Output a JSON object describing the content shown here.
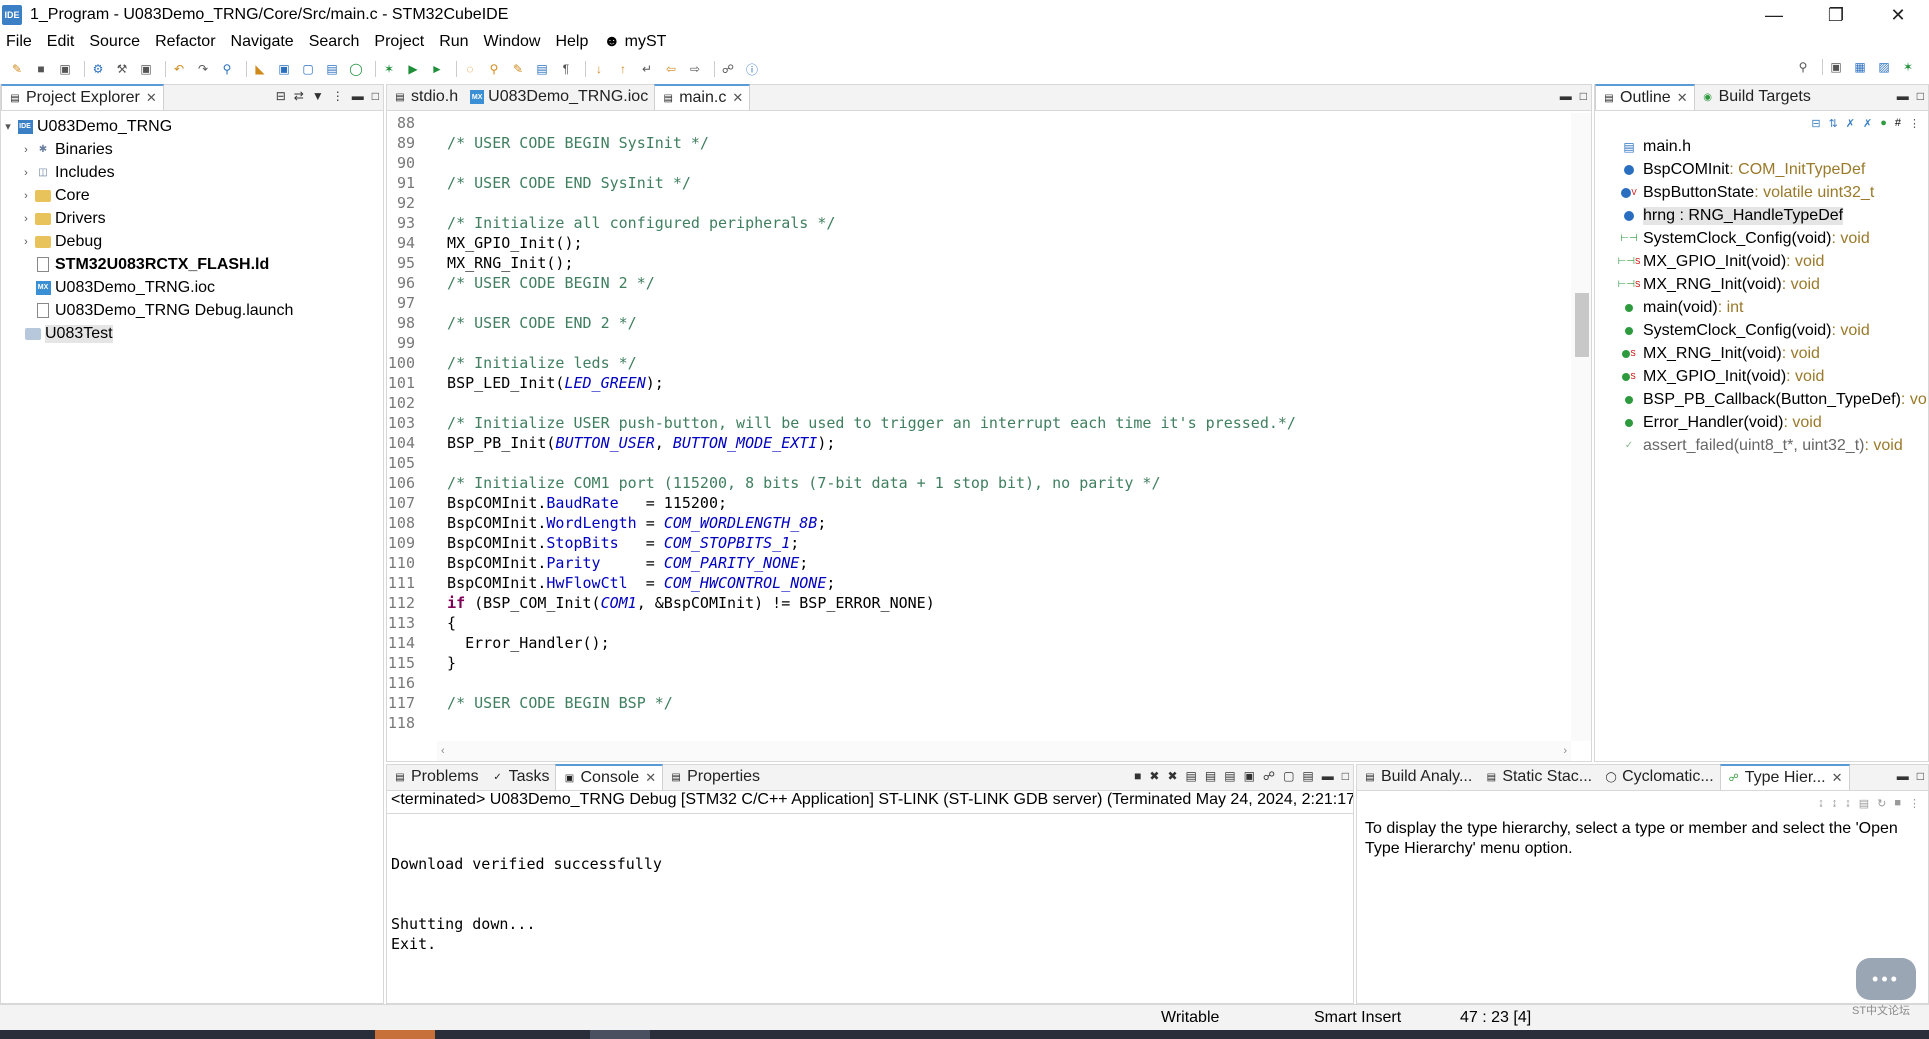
{
  "window": {
    "title": "1_Program - U083Demo_TRNG/Core/Src/main.c - STM32CubeIDE",
    "app_icon": "IDE"
  },
  "menu": [
    "File",
    "Edit",
    "Source",
    "Refactor",
    "Navigate",
    "Search",
    "Project",
    "Run",
    "Window",
    "Help",
    "myST"
  ],
  "project_explorer": {
    "tab_label": "Project Explorer",
    "tree": [
      {
        "label": "U083Demo_TRNG",
        "icon": "project-icon",
        "expanded": true
      },
      {
        "label": "Binaries",
        "icon": "binaries-icon"
      },
      {
        "label": "Includes",
        "icon": "includes-icon"
      },
      {
        "label": "Core",
        "icon": "folder-icon"
      },
      {
        "label": "Drivers",
        "icon": "folder-icon"
      },
      {
        "label": "Debug",
        "icon": "folder-icon"
      },
      {
        "label": "STM32U083RCTX_FLASH.ld",
        "icon": "linker-file-icon"
      },
      {
        "label": "U083Demo_TRNG.ioc",
        "icon": "mx-file-icon"
      },
      {
        "label": "U083Demo_TRNG Debug.launch",
        "icon": "launch-file-icon"
      },
      {
        "label": "U083Test",
        "icon": "closed-project-icon"
      }
    ]
  },
  "editor": {
    "tabs": [
      {
        "label": "stdio.h",
        "icon": "c-file-icon"
      },
      {
        "label": "U083Demo_TRNG.ioc",
        "icon": "mx-file-icon"
      },
      {
        "label": "main.c",
        "icon": "c-file-icon",
        "active": true
      }
    ],
    "lines": [
      {
        "n": "88",
        "t": ""
      },
      {
        "n": "89",
        "t": "  /* USER CODE BEGIN SysInit */"
      },
      {
        "n": "90",
        "t": ""
      },
      {
        "n": "91",
        "t": "  /* USER CODE END SysInit */"
      },
      {
        "n": "92",
        "t": ""
      },
      {
        "n": "93",
        "t": "  /* Initialize all configured peripherals */"
      },
      {
        "n": "94",
        "t": "  MX_GPIO_Init();"
      },
      {
        "n": "95",
        "t": "  MX_RNG_Init();"
      },
      {
        "n": "96",
        "t": "  /* USER CODE BEGIN 2 */"
      },
      {
        "n": "97",
        "t": ""
      },
      {
        "n": "98",
        "t": "  /* USER CODE END 2 */"
      },
      {
        "n": "99",
        "t": ""
      },
      {
        "n": "100",
        "t": "  /* Initialize leds */"
      },
      {
        "n": "101",
        "t": "  BSP_LED_Init(LED_GREEN);"
      },
      {
        "n": "102",
        "t": ""
      },
      {
        "n": "103",
        "t": "  /* Initialize USER push-button, will be used to trigger an interrupt each time it's pressed.*/"
      },
      {
        "n": "104",
        "t": "  BSP_PB_Init(BUTTON_USER, BUTTON_MODE_EXTI);"
      },
      {
        "n": "105",
        "t": ""
      },
      {
        "n": "106",
        "t": "  /* Initialize COM1 port (115200, 8 bits (7-bit data + 1 stop bit), no parity */"
      },
      {
        "n": "107",
        "t": "  BspCOMInit.BaudRate   = 115200;"
      },
      {
        "n": "108",
        "t": "  BspCOMInit.WordLength = COM_WORDLENGTH_8B;"
      },
      {
        "n": "109",
        "t": "  BspCOMInit.StopBits   = COM_STOPBITS_1;"
      },
      {
        "n": "110",
        "t": "  BspCOMInit.Parity     = COM_PARITY_NONE;"
      },
      {
        "n": "111",
        "t": "  BspCOMInit.HwFlowCtl  = COM_HWCONTROL_NONE;"
      },
      {
        "n": "112",
        "t": "  if (BSP_COM_Init(COM1, &BspCOMInit) != BSP_ERROR_NONE)"
      },
      {
        "n": "113",
        "t": "  {"
      },
      {
        "n": "114",
        "t": "    Error_Handler();"
      },
      {
        "n": "115",
        "t": "  }"
      },
      {
        "n": "116",
        "t": ""
      },
      {
        "n": "117",
        "t": "  /* USER CODE BEGIN BSP */"
      },
      {
        "n": "118",
        "t": ""
      }
    ]
  },
  "outline": {
    "tabs": [
      {
        "label": "Outline"
      },
      {
        "label": "Build Targets"
      }
    ],
    "items": [
      {
        "name": "main.h",
        "type": "",
        "icon": "include-icon"
      },
      {
        "name": "BspCOMInit",
        "type": " : COM_InitTypeDef",
        "icon": "variable-icon"
      },
      {
        "name": "BspButtonState",
        "type": " : volatile uint32_t",
        "icon": "volatile-variable-icon"
      },
      {
        "name": "hrng : RNG_HandleTypeDef",
        "type": "",
        "icon": "variable-icon",
        "selected": true
      },
      {
        "name": "SystemClock_Config(void)",
        "type": " : void",
        "icon": "function-decl-icon"
      },
      {
        "name": "MX_GPIO_Init(void)",
        "type": " : void",
        "icon": "static-function-decl-icon"
      },
      {
        "name": "MX_RNG_Init(void)",
        "type": " : void",
        "icon": "static-function-decl-icon"
      },
      {
        "name": "main(void)",
        "type": " : int",
        "icon": "function-icon"
      },
      {
        "name": "SystemClock_Config(void)",
        "type": " : void",
        "icon": "function-icon"
      },
      {
        "name": "MX_RNG_Init(void)",
        "type": " : void",
        "icon": "static-function-icon"
      },
      {
        "name": "MX_GPIO_Init(void)",
        "type": " : void",
        "icon": "static-function-icon"
      },
      {
        "name": "BSP_PB_Callback(Button_TypeDef)",
        "type": " : vo",
        "icon": "function-icon"
      },
      {
        "name": "Error_Handler(void)",
        "type": " : void",
        "icon": "function-icon"
      },
      {
        "name": "assert_failed(uint8_t*, uint32_t)",
        "type": " : void",
        "icon": "inactive-function-icon",
        "muted": true
      }
    ]
  },
  "console": {
    "tabs": [
      {
        "label": "Problems",
        "icon": "problems-icon"
      },
      {
        "label": "Tasks",
        "icon": "tasks-icon"
      },
      {
        "label": "Console",
        "icon": "console-icon",
        "active": true
      },
      {
        "label": "Properties",
        "icon": "properties-icon"
      }
    ],
    "status": "<terminated> U083Demo_TRNG Debug [STM32 C/C++ Application] ST-LINK (ST-LINK GDB server) (Terminated May 24, 2024, 2:21:17",
    "lines": [
      "",
      "",
      "Download verified successfully",
      "",
      "",
      "Shutting down...",
      "Exit."
    ]
  },
  "type_hierarchy": {
    "tabs": [
      {
        "label": "Build Analy...",
        "icon": "build-analyzer-icon"
      },
      {
        "label": "Static Stac...",
        "icon": "static-stack-icon"
      },
      {
        "label": "Cyclomatic...",
        "icon": "cyclomatic-icon"
      },
      {
        "label": "Type Hier...",
        "icon": "type-hierarchy-icon",
        "active": true
      }
    ],
    "message": "To display the type hierarchy, select a type or member and select the 'Open Type Hierarchy' menu option."
  },
  "statusbar": {
    "writable": "Writable",
    "insert_mode": "Smart Insert",
    "position": "47 : 23 [4]"
  },
  "chat_widget": {
    "label": "ST中文论坛"
  },
  "colors": {
    "accent": "#5b9bd5",
    "comment": "#3f7f5f",
    "field": "#0000c0",
    "keyword": "#7f0055",
    "type": "#9a7a2a"
  }
}
